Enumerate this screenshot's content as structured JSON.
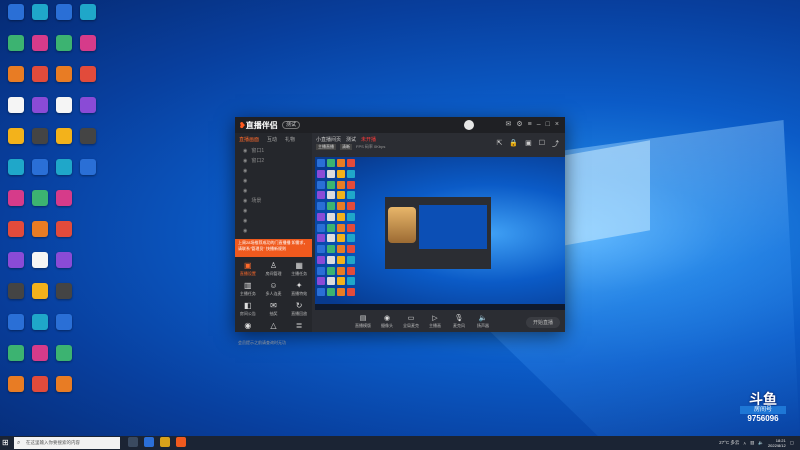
{
  "app": {
    "title": "直播伴侣",
    "version_tag": "测试",
    "left_tabs": [
      "直播画面",
      "互动",
      "礼物"
    ],
    "scene_rows": [
      "窗口1",
      "窗口2",
      "",
      "",
      "",
      "场景",
      "",
      "",
      ""
    ],
    "banner_text": "上周28场推荐成功的门直播播 如需求，请联系\"管理员\" 快播新规则",
    "tools": [
      {
        "label": "直播设置",
        "icon": "broadcast-icon",
        "hot": true
      },
      {
        "label": "房间管理",
        "icon": "person-icon",
        "hot": false
      },
      {
        "label": "主播任务",
        "icon": "clipboard-icon",
        "hot": false
      },
      {
        "label": "主播任务",
        "icon": "grid-icon",
        "hot": false
      },
      {
        "label": "多人连麦",
        "icon": "users-icon",
        "hot": false
      },
      {
        "label": "直播特效",
        "icon": "sparkle-icon",
        "hot": false
      },
      {
        "label": "房间公告",
        "icon": "megaphone-icon",
        "hot": false
      },
      {
        "label": "抽奖",
        "icon": "gift-icon",
        "hot": false
      },
      {
        "label": "直播回放",
        "icon": "replay-icon",
        "hot": false
      },
      {
        "label": "",
        "icon": "camera-icon",
        "hot": false
      },
      {
        "label": "",
        "icon": "up-icon",
        "hot": false
      },
      {
        "label": "",
        "icon": "layers-icon",
        "hot": false
      }
    ],
    "footer_text": "会员提示之前请查询时无功",
    "main_header": [
      "小直播间页",
      "测试",
      "未开播"
    ],
    "main_subheader": [
      "主播直播",
      "清晰",
      "FPS 码率 0Kbps"
    ],
    "controls": [
      "直播模版",
      "摄像头",
      "全局麦克",
      "主播画",
      "麦克风",
      "扬声器"
    ],
    "go_live": "开始直播"
  },
  "taskbar": {
    "search_placeholder": "在这里输入你要搜索的内容",
    "weather": "27°C 多云",
    "time": "18:21",
    "date": "2022/8/12"
  },
  "watermark": {
    "brand": "斗鱼",
    "label": "房间号",
    "room": "9756096"
  },
  "colors": {
    "accent": "#f05a1e",
    "app_bg": "#2b2d33",
    "desktop": "#0b5bc7"
  }
}
